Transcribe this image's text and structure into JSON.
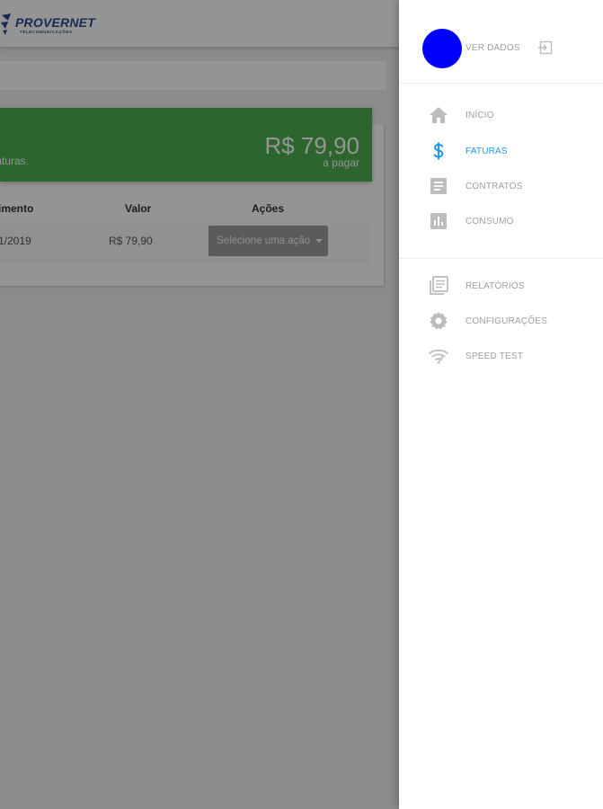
{
  "brand": {
    "name": "PROVERNET",
    "subtitle": "TELECOMUNICAÇÕES"
  },
  "banner": {
    "text": "faturas.",
    "amount": "R$ 79,90",
    "amount_caption": "a pagar",
    "color": "#4caf50"
  },
  "table": {
    "headers": [
      "imento",
      "Valor",
      "Ações"
    ],
    "rows": [
      {
        "vencimento": "1/2019",
        "valor": "R$ 79,90",
        "acao_placeholder": "Selecione uma ação"
      }
    ]
  },
  "drawer": {
    "profile_link": "VER DADOS",
    "avatar_color": "#0000ff",
    "accent_color": "#2196f3",
    "items": [
      {
        "label": "INÍCIO",
        "icon": "home-icon",
        "active": false
      },
      {
        "label": "FATURAS",
        "icon": "dollar-icon",
        "active": true
      },
      {
        "label": "CONTRATOS",
        "icon": "document-icon",
        "active": false
      },
      {
        "label": "CONSUMO",
        "icon": "bar-chart-icon",
        "active": false
      }
    ],
    "secondary_items": [
      {
        "label": "RELATÓRIOS",
        "icon": "reports-icon"
      },
      {
        "label": "CONFIGURAÇÕES",
        "icon": "gear-icon"
      },
      {
        "label": "SPEED TEST",
        "icon": "wifi-icon"
      }
    ]
  }
}
